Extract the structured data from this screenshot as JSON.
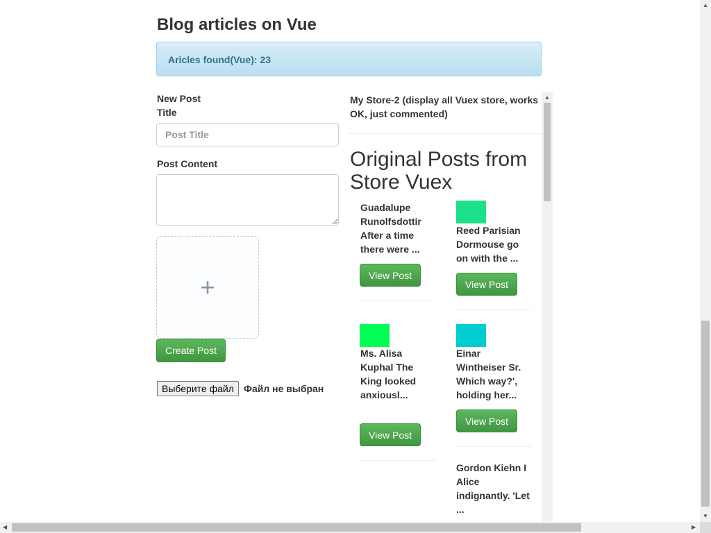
{
  "page": {
    "title": "Blog articles on Vue",
    "alert": "Aricles found(Vue): 23"
  },
  "form": {
    "new_post_label": "New Post",
    "title_label": "Title",
    "title_placeholder": "Post Title",
    "content_label": "Post Content",
    "upload_plus": "+",
    "create_label": "Create Post",
    "file_button_label": "Выберите файл",
    "file_status": "Файл не выбран"
  },
  "store": {
    "title": "My Store-2 (display all Vuex store, works OK, just commented)",
    "heading": "Original Posts from Store Vuex",
    "view_label": "View Post",
    "posts": [
      {
        "text": "Guadalupe Runolfsdottir After a time there were ..."
      },
      {
        "text": "Reed Parisian Dormouse go on with the ...",
        "thumb_color": "#1de08a"
      },
      {
        "text": "Ms. Alisa Kuphal The King looked anxiousl...",
        "thumb_color": "#00ff55"
      },
      {
        "text": "Einar Wintheiser Sr. Which way?', holding her...",
        "thumb_color": "#00cdd0"
      },
      {
        "text": "Gordon Kiehn I Alice indignantly. 'Let ..."
      }
    ]
  },
  "colors": {
    "success": "#5cb85c",
    "info_bg": "#d9edf7",
    "info_text": "#31708f"
  }
}
